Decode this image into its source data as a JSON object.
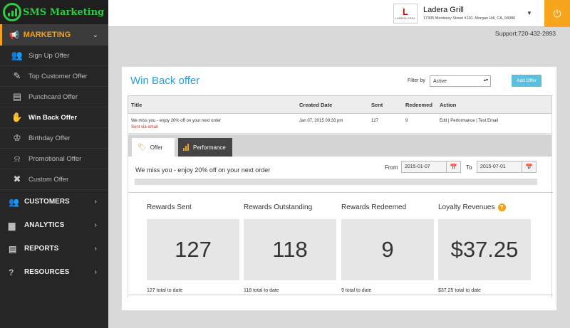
{
  "brand": {
    "title": "SMS Marketing"
  },
  "sidebar": {
    "section": "MARKETING",
    "items": [
      {
        "label": "Sign Up Offer",
        "icon": "add-user-icon"
      },
      {
        "label": "Top Customer Offer",
        "icon": "edit-icon"
      },
      {
        "label": "Punchcard Offer",
        "icon": "punchcard-icon"
      },
      {
        "label": "Win Back Offer",
        "icon": "handshake-icon",
        "active": true
      },
      {
        "label": "Birthday Offer",
        "icon": "cake-icon"
      },
      {
        "label": "Promotional Offer",
        "icon": "bell-icon"
      },
      {
        "label": "Custom Offer",
        "icon": "tools-icon"
      }
    ],
    "sections": [
      {
        "label": "CUSTOMERS"
      },
      {
        "label": "ANALYTICS"
      },
      {
        "label": "REPORTS"
      },
      {
        "label": "RESOURCES"
      }
    ]
  },
  "header": {
    "logo_mark": "L",
    "logo_text": "LADERA GRILL",
    "restaurant": "Ladera Grill",
    "address": "17305 Monterey Street #110, Morgan Hill, CA, 94086",
    "support": "Support:720-432-2893"
  },
  "main": {
    "title": "Win Back offer",
    "filter_label": "Filter by",
    "filter_value": "Active",
    "add_button": "Add Offer",
    "table": {
      "headers": [
        "Title",
        "Created Date",
        "Sent",
        "Redeemed",
        "Action"
      ],
      "row": {
        "title": "We miss you - enjoy 20% off on your next order",
        "status": "Sent via email",
        "date": "Jan 07, 2015 09:33 pm",
        "sent": "127",
        "redeemed": "9",
        "actions": "Edit | Performance | Test Email"
      }
    },
    "tabs": [
      {
        "label": "Offer"
      },
      {
        "label": "Performance"
      }
    ],
    "offer_name": "We miss you - enjoy 20% off on your next order",
    "from_label": "From",
    "from_date": "2015-01-07",
    "to_label": "To",
    "to_date": "2015-07-01",
    "stats": [
      {
        "label": "Rewards Sent",
        "value": "127",
        "total": "127 total to date"
      },
      {
        "label": "Rewards Outstanding",
        "value": "118",
        "total": "118 total to date"
      },
      {
        "label": "Rewards Redeemed",
        "value": "9",
        "total": "9 total to date"
      },
      {
        "label": "Loyalty Revenues",
        "value": "$37.25",
        "total": "$37.25 total to date"
      }
    ]
  },
  "colors": {
    "accent": "#f4a11a",
    "brand_green": "#2ecc40",
    "title_blue": "#2a9fd8",
    "button_blue": "#5bc0de"
  }
}
